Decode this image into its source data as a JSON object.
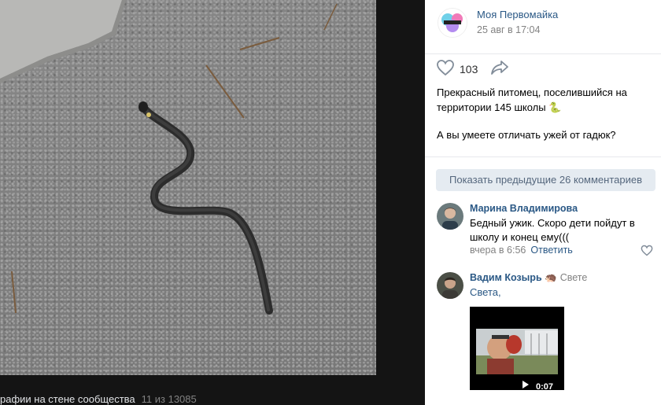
{
  "viewer": {
    "caption": "рафии на стене сообщества",
    "counter": "11 из 13085"
  },
  "post": {
    "group_name": "Моя Первомайка",
    "date": "25 авг в 17:04",
    "likes": "103",
    "text_line1": "Прекрасный питомец, поселившийся на территории 145 школы",
    "snake_emoji": "🐍",
    "text_line2": "А вы умеете отличать ужей от гадюк?"
  },
  "comments": {
    "show_previous": "Показать предыдущие 26 комментариев",
    "items": [
      {
        "author": "Марина Владимирова",
        "text": "Бедный ужик. Скоро дети пойдут в школу и конец ему(((",
        "time": "вчера в 6:56",
        "reply": "Ответить"
      },
      {
        "author": "Вадим Козырь",
        "hedgehog": "🦔",
        "reply_to": "Свете",
        "addressee": "Света,",
        "video_duration": "0:07"
      }
    ]
  },
  "colors": {
    "link": "#2a5885",
    "muted": "#828282",
    "button_bg": "#e5ebf1",
    "button_text": "#55677d",
    "viewer_bg": "#141414"
  }
}
